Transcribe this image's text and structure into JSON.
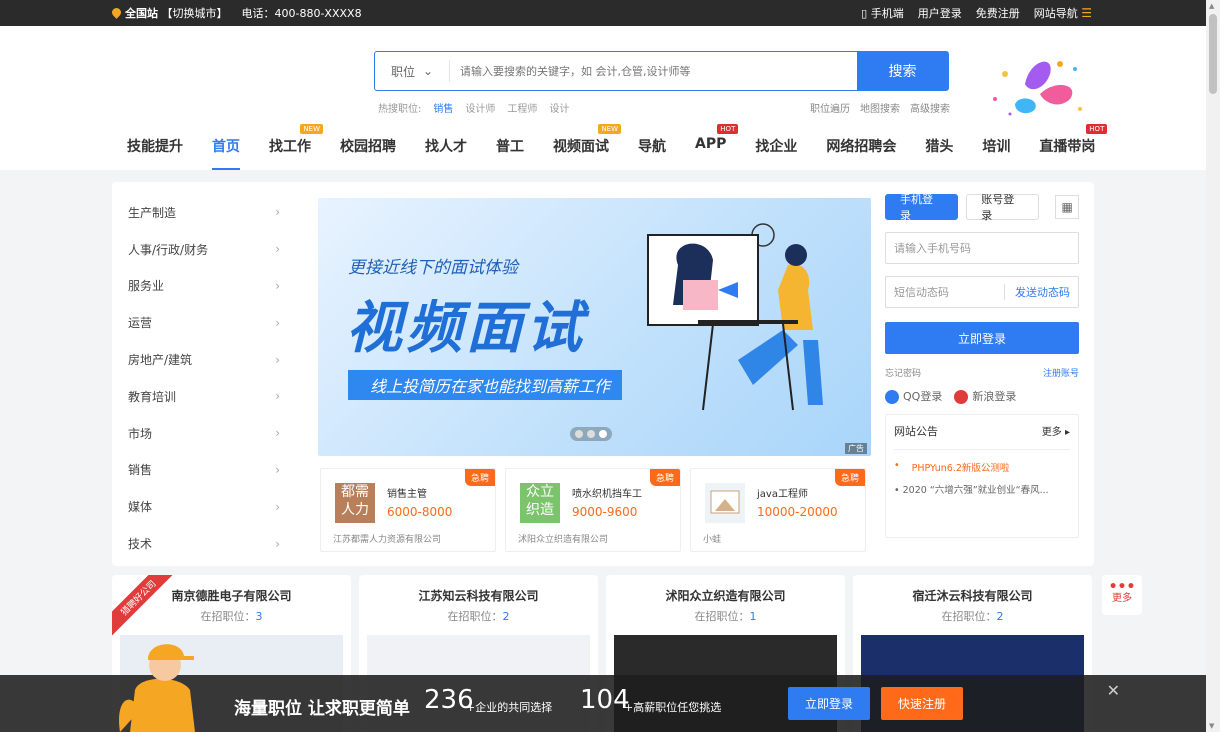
{
  "topbar": {
    "location": "全国站",
    "switch_city": "【切换城市】",
    "phone": "电话：400-880-XXXX8",
    "mobile": "手机端",
    "user_login": "用户登录",
    "register": "免费注册",
    "site_nav": "网站导航"
  },
  "search": {
    "type": "职位",
    "placeholder": "请输入要搜索的关键字，如 会计,仓管,设计师等",
    "button": "搜索"
  },
  "hot": {
    "label": "热搜职位:",
    "items": [
      "销售",
      "设计师",
      "工程师",
      "设计"
    ],
    "right": [
      "职位遍历",
      "地图搜索",
      "高级搜索"
    ]
  },
  "nav": [
    {
      "label": "技能提升",
      "badge": ""
    },
    {
      "label": "首页",
      "badge": ""
    },
    {
      "label": "找工作",
      "badge": "NEW"
    },
    {
      "label": "校园招聘",
      "badge": ""
    },
    {
      "label": "找人才",
      "badge": ""
    },
    {
      "label": "普工",
      "badge": ""
    },
    {
      "label": "视频面试",
      "badge": "NEW"
    },
    {
      "label": "导航",
      "badge": ""
    },
    {
      "label": "APP",
      "badge": "HOT"
    },
    {
      "label": "找企业",
      "badge": ""
    },
    {
      "label": "网络招聘会",
      "badge": ""
    },
    {
      "label": "猎头",
      "badge": ""
    },
    {
      "label": "培训",
      "badge": ""
    },
    {
      "label": "直播带岗",
      "badge": "HOT"
    }
  ],
  "categories": [
    "生产制造",
    "人事/行政/财务",
    "服务业",
    "运营",
    "房地产/建筑",
    "教育培训",
    "市场",
    "销售",
    "媒体",
    "技术"
  ],
  "banner": {
    "line1": "更接近线下的面试体验",
    "line2": "视频面试",
    "line3": "线上投简历在家也能找到高薪工作",
    "ad": "广告"
  },
  "jobs": [
    {
      "logo": "都需人力",
      "title": "销售主管",
      "salary": "6000-8000",
      "company": "江苏都需人力资源有限公司",
      "tag": "急聘",
      "color": "#b87f5a"
    },
    {
      "logo": "众立织造",
      "title": "喷水织机挡车工",
      "salary": "9000-9600",
      "company": "沭阳众立织造有限公司",
      "tag": "急聘",
      "color": "#7cc46b"
    },
    {
      "logo": "",
      "title": "java工程师",
      "salary": "10000-20000",
      "company": "小蛙",
      "tag": "急聘",
      "color": "#ffffff"
    }
  ],
  "login": {
    "tab_phone": "手机登录",
    "tab_account": "账号登录",
    "phone_ph": "请输入手机号码",
    "sms_ph": "短信动态码",
    "send_code": "发送动态码",
    "submit": "立即登录",
    "forgot": "忘记密码",
    "register": "注册账号",
    "qq": "QQ登录",
    "weibo": "新浪登录"
  },
  "notice": {
    "title": "网站公告",
    "more": "更多",
    "items": [
      "PHPYun6.2新版公测啦",
      "2020 “六增六强”就业创业“春风..."
    ]
  },
  "companies": [
    {
      "name": "南京德胜电子有限公司",
      "jobs_label": "在招职位：",
      "jobs": "3",
      "ribbon": "猎聘好公司"
    },
    {
      "name": "江苏知云科技有限公司",
      "jobs_label": "在招职位：",
      "jobs": "2",
      "ribbon": ""
    },
    {
      "name": "沭阳众立织造有限公司",
      "jobs_label": "在招职位：",
      "jobs": "1",
      "ribbon": ""
    },
    {
      "name": "宿迁沐云科技有限公司",
      "jobs_label": "在招职位：",
      "jobs": "2",
      "ribbon": ""
    }
  ],
  "more_label": "更多",
  "bottom": {
    "slogan": "海量职位 让求职更简单",
    "num1": "236",
    "desc1": "+企业的共同选择",
    "num2": "104",
    "desc2": "+高薪职位任您挑选",
    "login": "立即登录",
    "register": "快速注册"
  },
  "colors": {
    "primary": "#2f7bf2",
    "orange": "#ff6a1a",
    "hot": "#e02e2e",
    "new": "#f5a623"
  }
}
